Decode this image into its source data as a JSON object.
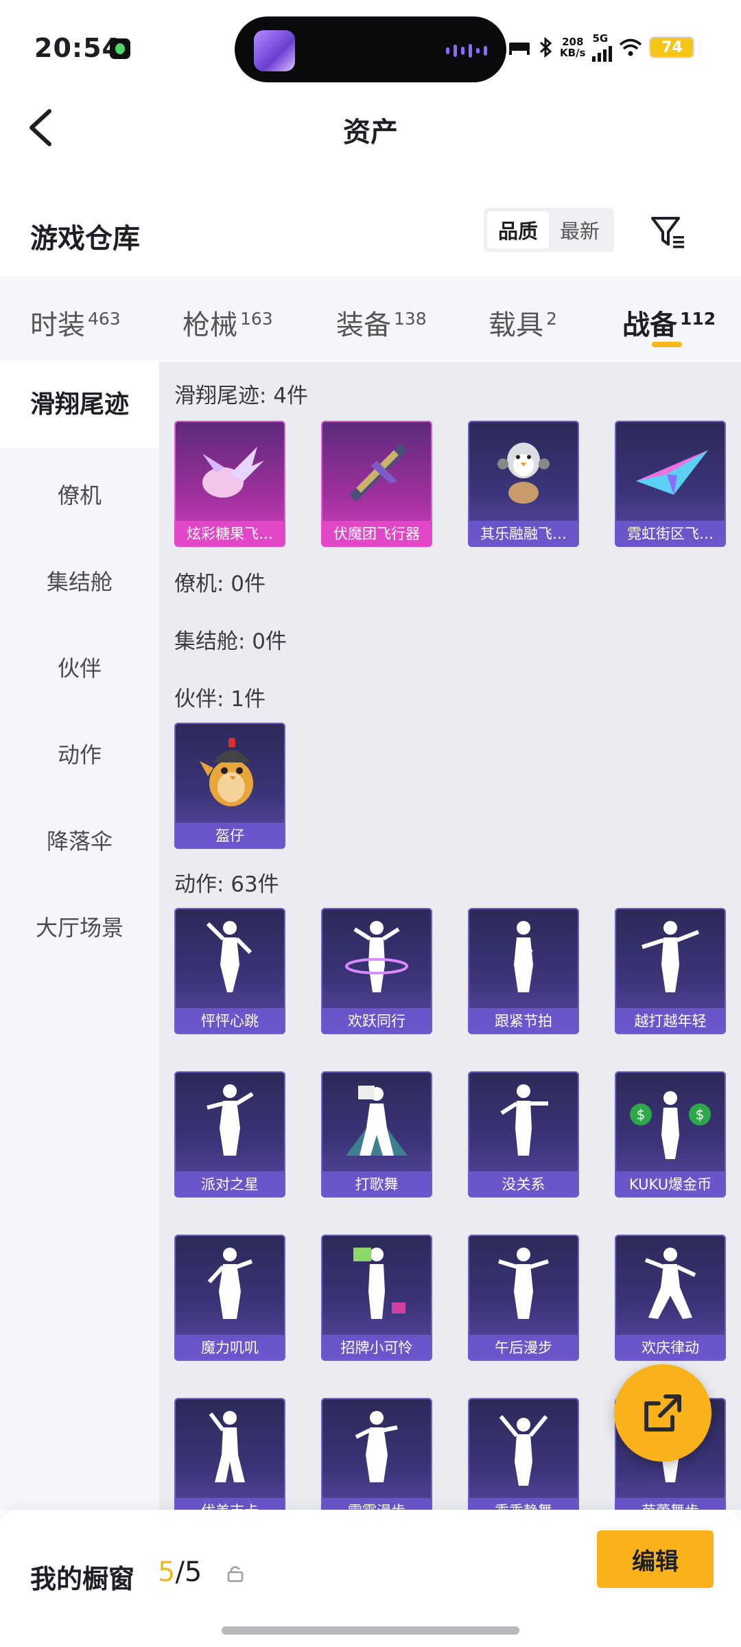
{
  "status_bar": {
    "time": "20:54",
    "net_speed_value": "208",
    "net_speed_unit": "KB/s",
    "network": "5G",
    "battery": "74"
  },
  "header": {
    "title": "资产"
  },
  "warehouse": {
    "title": "游戏仓库",
    "sort_options": [
      "品质",
      "最新"
    ],
    "active_sort": "品质"
  },
  "tabs": [
    {
      "label": "时装",
      "count": "463"
    },
    {
      "label": "枪械",
      "count": "163"
    },
    {
      "label": "装备",
      "count": "138"
    },
    {
      "label": "载具",
      "count": "2"
    },
    {
      "label": "战备",
      "count": "112"
    }
  ],
  "sidebar": [
    "滑翔尾迹",
    "僚机",
    "集结舱",
    "伙伴",
    "动作",
    "降落伞",
    "大厅场景"
  ],
  "groups": [
    {
      "title": "滑翔尾迹: 4件",
      "items": [
        "炫彩糖果飞…",
        "伏魔团飞行器",
        "其乐融融飞…",
        "霓虹街区飞…"
      ]
    },
    {
      "title": "僚机: 0件",
      "items": []
    },
    {
      "title": "集结舱: 0件",
      "items": []
    },
    {
      "title": "伙伴: 1件",
      "items": [
        "盔仔"
      ]
    },
    {
      "title": "动作: 63件",
      "items": [
        "怦怦心跳",
        "欢跃同行",
        "跟紧节拍",
        "越打越年轻",
        "派对之星",
        "打歌舞",
        "没关系",
        "KUKU爆金币",
        "魔力叽叽",
        "招牌小可怜",
        "午后漫步",
        "欢庆律动",
        "优美吉卡",
        "雷霆漫步",
        "乖乖静舞",
        "芭蕾舞步"
      ]
    }
  ],
  "showcase": {
    "label": "我的橱窗",
    "current": "5",
    "total": "/5"
  },
  "edit_label": "编辑",
  "icons": {
    "back": "chevron-left-icon",
    "filter": "filter-icon",
    "share": "share-icon",
    "lock": "lock-icon"
  }
}
